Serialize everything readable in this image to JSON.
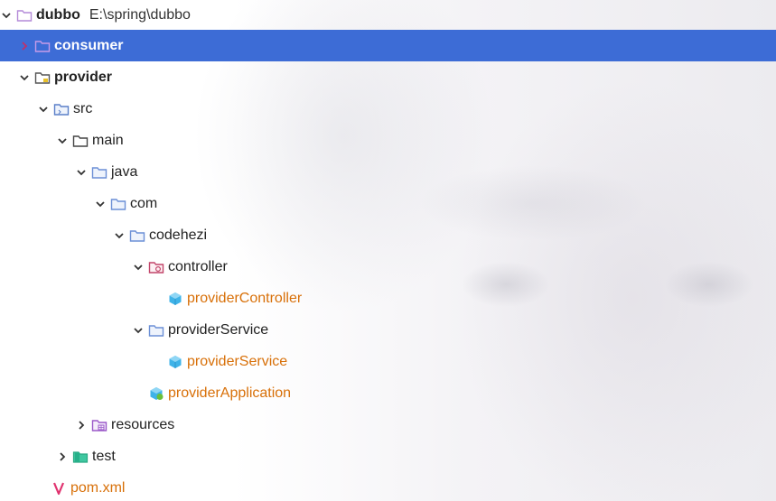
{
  "tree": {
    "root": {
      "label": "dubbo",
      "path": "E:\\spring\\dubbo"
    },
    "consumer": {
      "label": "consumer"
    },
    "provider": {
      "label": "provider"
    },
    "src": {
      "label": "src"
    },
    "main": {
      "label": "main"
    },
    "java": {
      "label": "java"
    },
    "com": {
      "label": "com"
    },
    "codehezi": {
      "label": "codehezi"
    },
    "controller": {
      "label": "controller"
    },
    "providerController": {
      "label": "providerController"
    },
    "providerServiceFolder": {
      "label": "providerService"
    },
    "providerServiceClass": {
      "label": "providerService"
    },
    "providerApplication": {
      "label": "providerApplication"
    },
    "resources": {
      "label": "resources"
    },
    "test": {
      "label": "test"
    },
    "pom": {
      "label": "pom.xml"
    }
  },
  "colors": {
    "selection": "#3d6cd6",
    "class_file": "#d87009",
    "folder": "#6b8fd6"
  }
}
